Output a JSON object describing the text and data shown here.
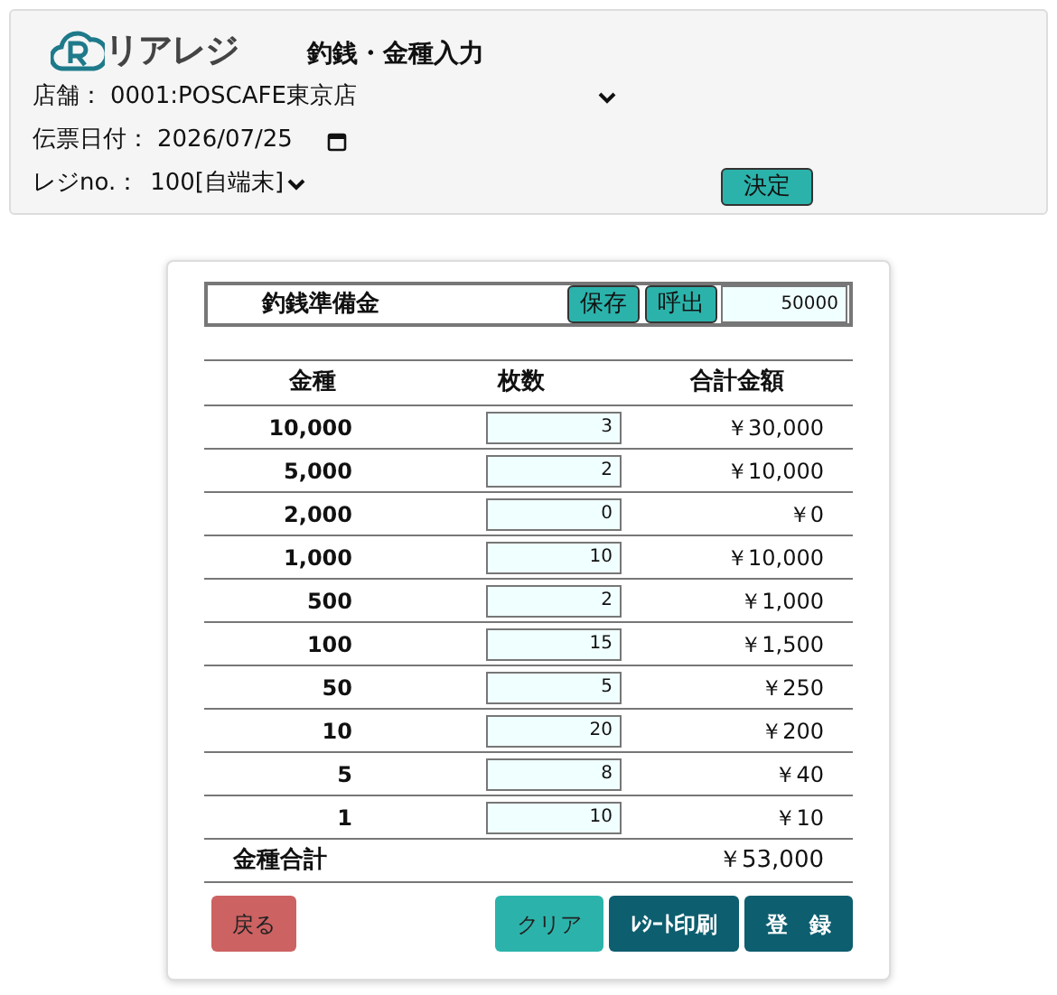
{
  "header": {
    "logo_text": "リアレジ",
    "title": "釣銭・金種入力",
    "fields": [
      {
        "kind": "select",
        "label": "店舗：",
        "value": "0001:POSCAFE東京店"
      },
      {
        "kind": "date",
        "label": "伝票日付：",
        "value": "2026/07/25"
      },
      {
        "kind": "select_short",
        "label": "レジno.：",
        "value": "100[自端末]"
      }
    ],
    "submit": "決定"
  },
  "reserve": {
    "label": "釣銭準備金",
    "save": "保存",
    "recall": "呼出",
    "value": "50000"
  },
  "table": {
    "columns": [
      "金種",
      "枚数",
      "合計金額"
    ],
    "rows": [
      {
        "denomination": "10,000",
        "count": "3",
        "amount": "￥30,000"
      },
      {
        "denomination": "5,000",
        "count": "2",
        "amount": "￥10,000"
      },
      {
        "denomination": "2,000",
        "count": "0",
        "amount": "￥0"
      },
      {
        "denomination": "1,000",
        "count": "10",
        "amount": "￥10,000"
      },
      {
        "denomination": "500",
        "count": "2",
        "amount": "￥1,000"
      },
      {
        "denomination": "100",
        "count": "15",
        "amount": "￥1,500"
      },
      {
        "denomination": "50",
        "count": "5",
        "amount": "￥250"
      },
      {
        "denomination": "10",
        "count": "20",
        "amount": "￥200"
      },
      {
        "denomination": "5",
        "count": "8",
        "amount": "￥40"
      },
      {
        "denomination": "1",
        "count": "10",
        "amount": "￥10"
      }
    ],
    "total_label": "金種合計",
    "total": "￥53,000"
  },
  "buttons": [
    {
      "kind": "back",
      "label": "戻る"
    },
    {
      "kind": "clear",
      "label": "クリア"
    },
    {
      "kind": "print",
      "label": "ﾚｼｰﾄ印刷"
    },
    {
      "kind": "register",
      "label": "登　録"
    }
  ]
}
